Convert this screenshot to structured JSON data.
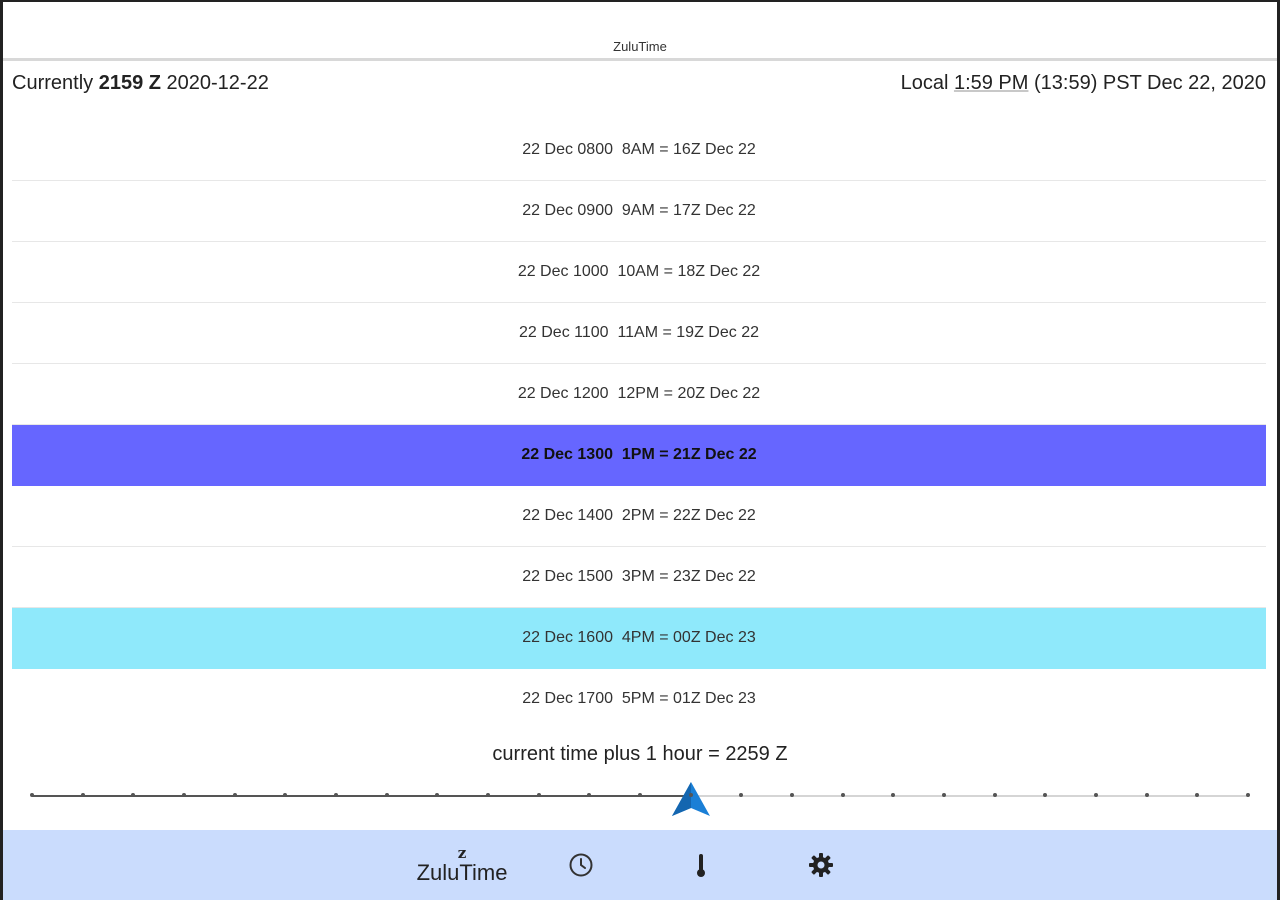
{
  "app": {
    "title": "ZuluTime"
  },
  "status": {
    "current_label": "Currently",
    "current_zulu": "2159 Z",
    "current_date": "2020-12-22",
    "local_prefix": "Local",
    "local_time": "1:59 PM",
    "local_rest": "(13:59) PST Dec 22, 2020"
  },
  "rows": [
    {
      "text": "22 Dec 0800  8AM = 16Z Dec 22",
      "state": ""
    },
    {
      "text": "22 Dec 0900  9AM = 17Z Dec 22",
      "state": ""
    },
    {
      "text": "22 Dec 1000  10AM = 18Z Dec 22",
      "state": ""
    },
    {
      "text": "22 Dec 1100  11AM = 19Z Dec 22",
      "state": ""
    },
    {
      "text": "22 Dec 1200  12PM = 20Z Dec 22",
      "state": ""
    },
    {
      "text": "22 Dec 1300  1PM = 21Z Dec 22",
      "state": "current"
    },
    {
      "text": "22 Dec 1400  2PM = 22Z Dec 22",
      "state": ""
    },
    {
      "text": "22 Dec 1500  3PM = 23Z Dec 22",
      "state": ""
    },
    {
      "text": "22 Dec 1600  4PM = 00Z Dec 23",
      "state": "next"
    },
    {
      "text": "22 Dec 1700  5PM = 01Z Dec 23",
      "state": ""
    }
  ],
  "offset": {
    "label": "current time plus 1 hour = 2259 Z",
    "slider_steps": 24,
    "slider_value": 13
  },
  "bottom_nav": {
    "brand_glyph": "z",
    "brand_name": "ZuluTime",
    "items": [
      {
        "name": "clock-icon"
      },
      {
        "name": "thermometer-icon"
      },
      {
        "name": "gear-icon"
      }
    ]
  },
  "colors": {
    "current_row": "#6666ff",
    "next_row": "#8fe9fb",
    "bottom_bar": "#cadcfd",
    "thumb": "#1a7fd6"
  }
}
